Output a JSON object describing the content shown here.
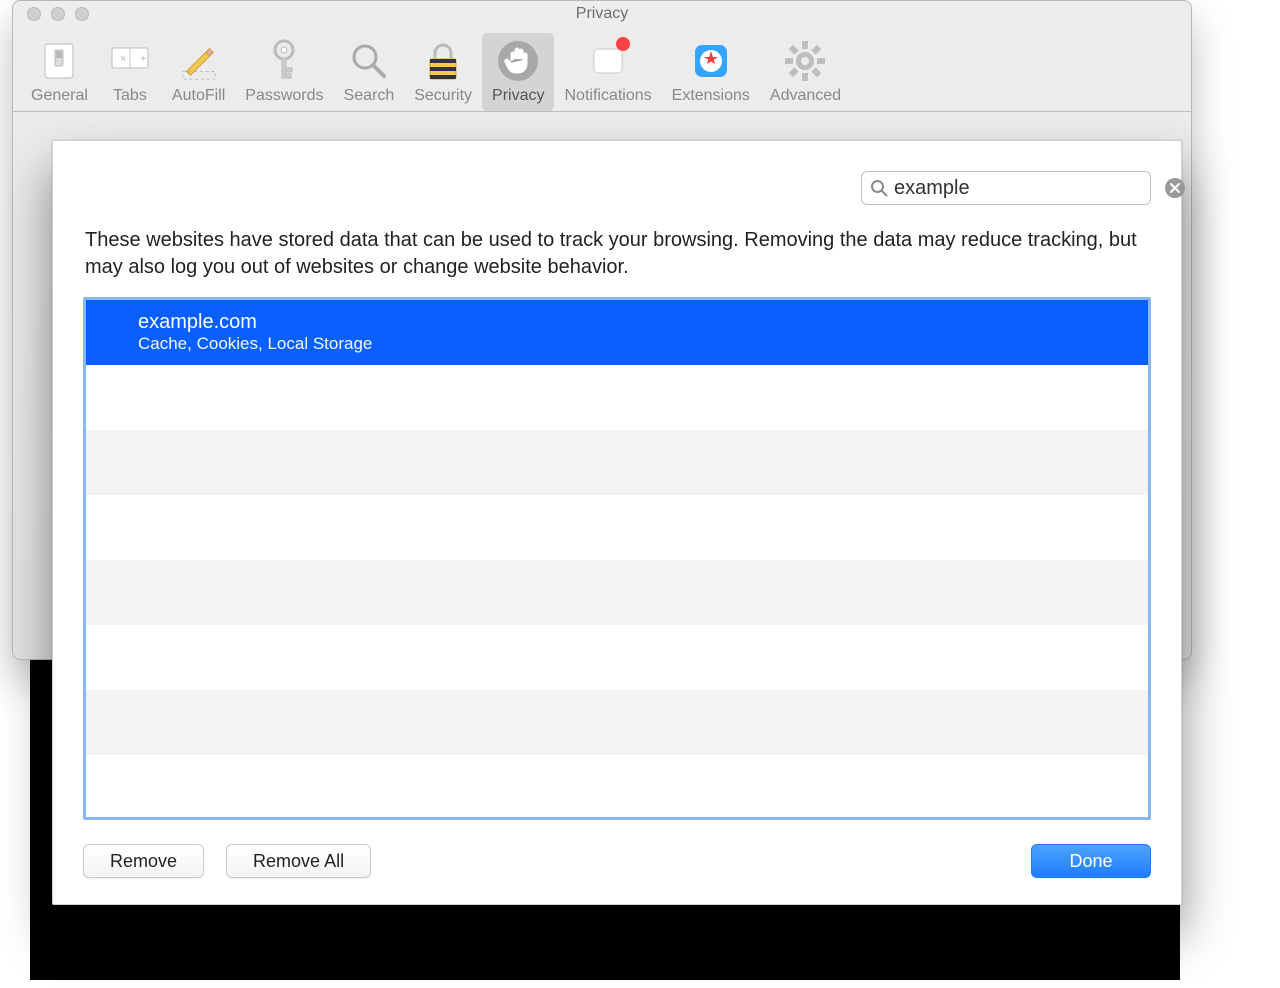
{
  "window": {
    "title": "Privacy"
  },
  "toolbar": {
    "items": [
      {
        "id": "general",
        "label": "General"
      },
      {
        "id": "tabs",
        "label": "Tabs"
      },
      {
        "id": "autofill",
        "label": "AutoFill"
      },
      {
        "id": "passwords",
        "label": "Passwords"
      },
      {
        "id": "search",
        "label": "Search"
      },
      {
        "id": "security",
        "label": "Security"
      },
      {
        "id": "privacy",
        "label": "Privacy",
        "selected": true
      },
      {
        "id": "notifications",
        "label": "Notifications",
        "badge": true
      },
      {
        "id": "extensions",
        "label": "Extensions"
      },
      {
        "id": "advanced",
        "label": "Advanced"
      }
    ]
  },
  "sheet": {
    "search_value": "example",
    "description": "These websites have stored data that can be used to track your browsing. Removing the data may reduce tracking, but may also log you out of websites or change website behavior.",
    "rows": [
      {
        "domain": "example.com",
        "types": "Cache, Cookies, Local Storage",
        "selected": true
      }
    ],
    "buttons": {
      "remove": "Remove",
      "remove_all": "Remove All",
      "done": "Done"
    }
  }
}
